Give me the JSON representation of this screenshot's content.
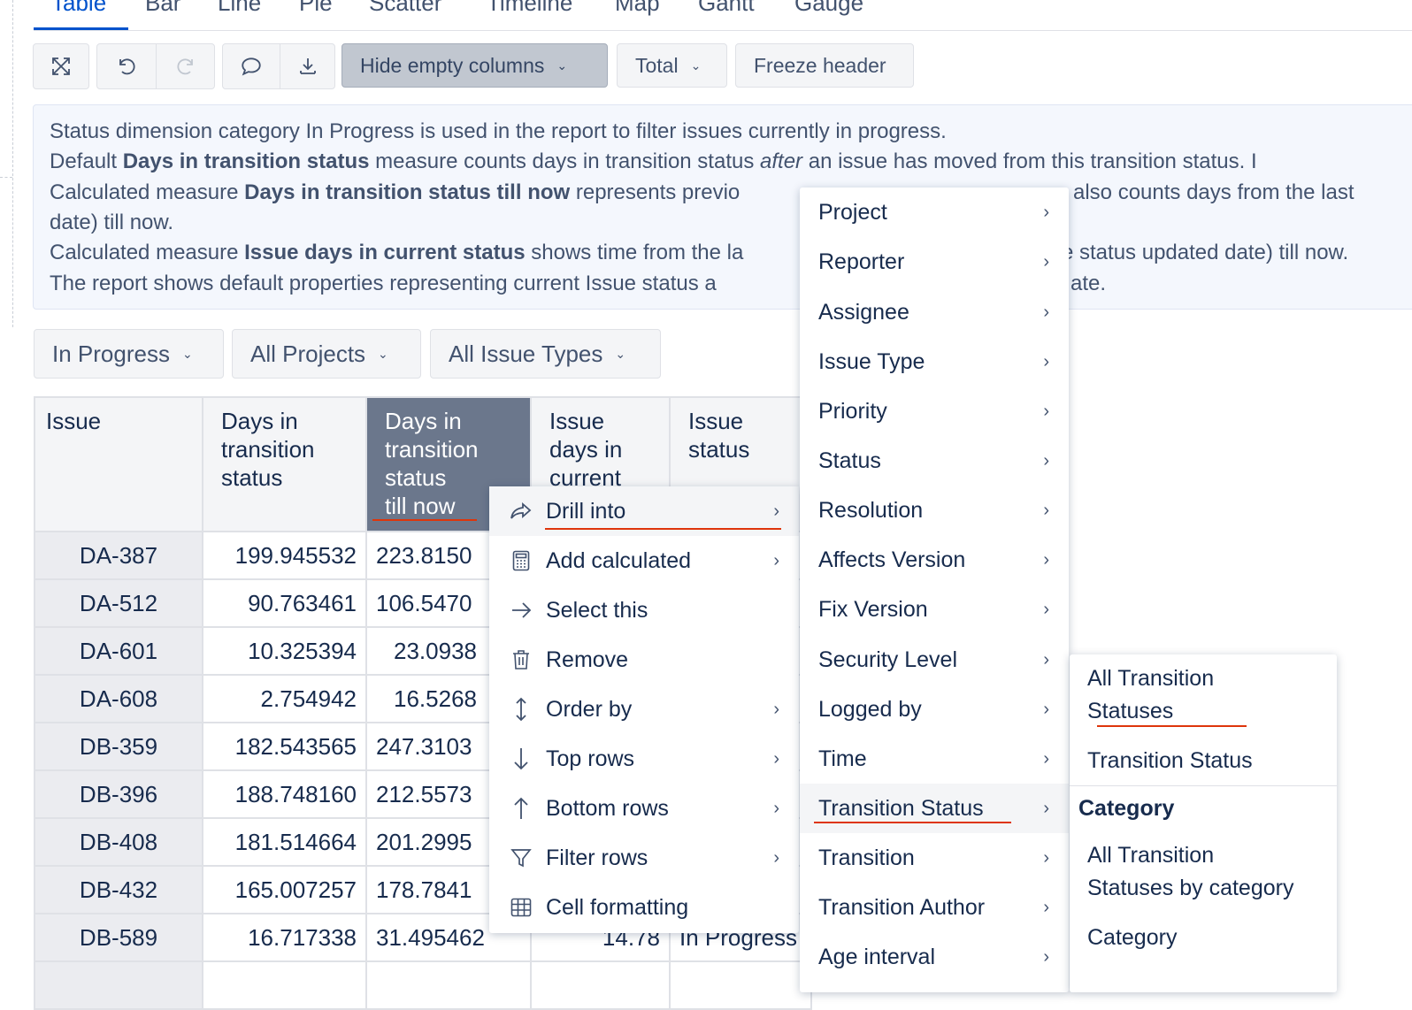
{
  "tabs": [
    "Table",
    "Bar",
    "Line",
    "Pie",
    "Scatter",
    "Timeline",
    "Map",
    "Gantt",
    "Gauge"
  ],
  "toolbar": {
    "fullscreen_icon": "fullscreen-icon",
    "undo_icon": "undo-icon",
    "redo_icon": "redo-icon",
    "comment_icon": "comment-icon",
    "export_icon": "download-icon",
    "hide_empty": "Hide empty columns",
    "total": "Total",
    "freeze": "Freeze header"
  },
  "info": {
    "line1": "Status dimension category In Progress is used in the report to filter issues currently in progress.",
    "line2_a": "Default ",
    "line2_b": "Days in transition status",
    "line2_c": " measure counts days in transition status ",
    "line2_d": "after",
    "line2_e": " an issue has moved from this transition status. I",
    "line3_a": "Calculated measure ",
    "line3_b": "Days in transition status till now",
    "line3_c": " represents previo",
    "line3_d": "also counts days from the last",
    "line4": "date) till now.",
    "line5_a": "Calculated measure ",
    "line5_b": "Issue days in current status",
    "line5_c": " shows time from the la",
    "line5_d": "e status updated date) till now.",
    "line6_a": "The report shows default properties representing current Issue status a",
    "line6_b": "ate."
  },
  "filters": [
    "In Progress",
    "All Projects",
    "All Issue Types"
  ],
  "table": {
    "headers": [
      "Issue",
      "Days in transition status",
      "Days in transition status till now",
      "Issue days in current",
      "Issue status"
    ],
    "header_lines": {
      "h1": [
        "Days in",
        "transition",
        "status"
      ],
      "h2": [
        "Days in",
        "transition",
        "status",
        "till now"
      ],
      "h3": [
        "Issue",
        "days in",
        "current"
      ],
      "h4": [
        "Issue",
        "status"
      ]
    },
    "rows": [
      {
        "issue": "DA-387",
        "d1": "199.945532",
        "d2": "223.8150",
        "d3": "",
        "status": ""
      },
      {
        "issue": "DA-512",
        "d1": "90.763461",
        "d2": "106.5470",
        "d3": "",
        "status": ""
      },
      {
        "issue": "DA-601",
        "d1": "10.325394",
        "d2": "23.0938",
        "d3": "",
        "status": ""
      },
      {
        "issue": "DA-608",
        "d1": "2.754942",
        "d2": "16.5268",
        "d3": "",
        "status": ""
      },
      {
        "issue": "DB-359",
        "d1": "182.543565",
        "d2": "247.3103",
        "d3": "",
        "status": ""
      },
      {
        "issue": "DB-396",
        "d1": "188.748160",
        "d2": "212.5573",
        "d3": "",
        "status": ""
      },
      {
        "issue": "DB-408",
        "d1": "181.514664",
        "d2": "201.2995",
        "d3": "",
        "status": ""
      },
      {
        "issue": "DB-432",
        "d1": "165.007257",
        "d2": "178.7841",
        "d3": "",
        "status": ""
      },
      {
        "issue": "DB-589",
        "d1": "16.717338",
        "d2": "31.495462",
        "d3": "14.78",
        "status": "In Progress"
      }
    ]
  },
  "context_menu": [
    {
      "label": "Drill into",
      "icon": "share-arrow-icon",
      "submenu": true
    },
    {
      "label": "Add calculated",
      "icon": "calculator-icon",
      "submenu": true
    },
    {
      "label": "Select this",
      "icon": "arrow-right-icon",
      "submenu": false
    },
    {
      "label": "Remove",
      "icon": "trash-icon",
      "submenu": false
    },
    {
      "label": "Order by",
      "icon": "sort-icon",
      "submenu": true
    },
    {
      "label": "Top rows",
      "icon": "arrow-down-icon",
      "submenu": true
    },
    {
      "label": "Bottom rows",
      "icon": "arrow-up-icon",
      "submenu": true
    },
    {
      "label": "Filter rows",
      "icon": "filter-icon",
      "submenu": true
    },
    {
      "label": "Cell formatting",
      "icon": "table-icon",
      "submenu": false
    }
  ],
  "dimensions_menu": [
    "Project",
    "Reporter",
    "Assignee",
    "Issue Type",
    "Priority",
    "Status",
    "Resolution",
    "Affects Version",
    "Fix Version",
    "Security Level",
    "Logged by",
    "Time",
    "Transition Status",
    "Transition",
    "Transition Author",
    "Age interval"
  ],
  "levels_menu": {
    "all_transition_1": "All Transition",
    "all_transition_2": "Statuses",
    "transition_status": "Transition Status",
    "category_header": "Category",
    "all_by_cat_1": "All Transition",
    "all_by_cat_2": "Statuses by category",
    "category": "Category"
  },
  "colors": {
    "accent": "#0052cc",
    "selected_header": "#6b778c",
    "underline": "#de350b"
  }
}
